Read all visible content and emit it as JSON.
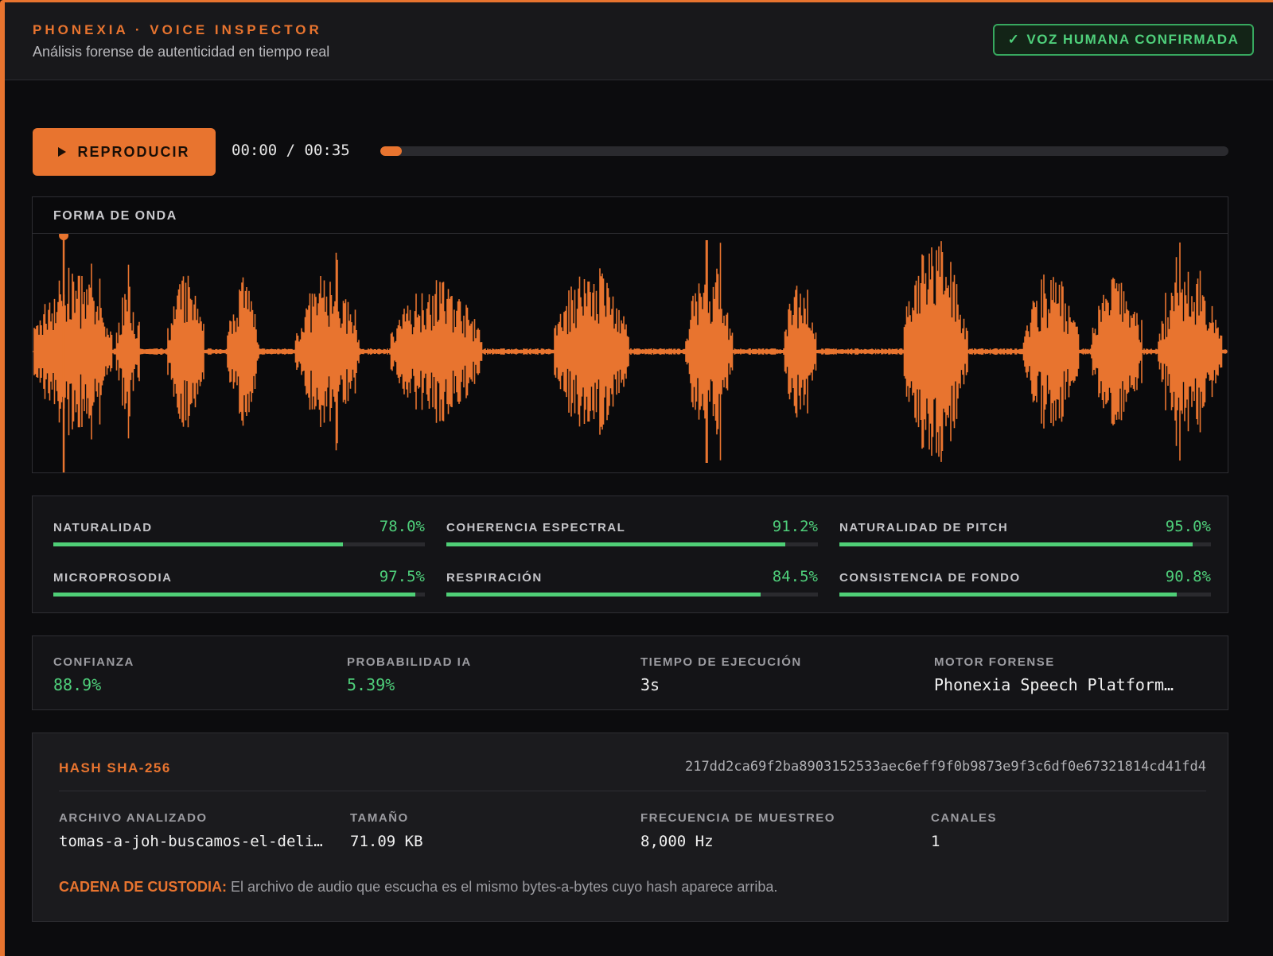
{
  "header": {
    "brand": "PHONEXIA · VOICE INSPECTOR",
    "subtitle": "Análisis forense de autenticidad en tiempo real",
    "verdict_icon": "check-icon",
    "verdict_symbol": "✓",
    "verdict_label": "VOZ HUMANA CONFIRMADA"
  },
  "player": {
    "play_label": "REPRODUCIR",
    "time": "00:00 / 00:35",
    "progress_fraction": 0.025
  },
  "waveform": {
    "title": "FORMA DE ONDA",
    "color": "#e8742f",
    "playhead_fraction": 0.026
  },
  "metrics": [
    {
      "label": "NATURALIDAD",
      "value": "78.0%",
      "fraction": 0.78
    },
    {
      "label": "COHERENCIA ESPECTRAL",
      "value": "91.2%",
      "fraction": 0.912
    },
    {
      "label": "NATURALIDAD DE PITCH",
      "value": "95.0%",
      "fraction": 0.95
    },
    {
      "label": "MICROPROSODIA",
      "value": "97.5%",
      "fraction": 0.975
    },
    {
      "label": "RESPIRACIÓN",
      "value": "84.5%",
      "fraction": 0.845
    },
    {
      "label": "CONSISTENCIA DE FONDO",
      "value": "90.8%",
      "fraction": 0.908
    }
  ],
  "stats": [
    {
      "label": "CONFIANZA",
      "value": "88.9%",
      "highlight": true
    },
    {
      "label": "PROBABILIDAD IA",
      "value": "5.39%",
      "highlight": true
    },
    {
      "label": "TIEMPO DE EJECUCIÓN",
      "value": "3s",
      "highlight": false
    },
    {
      "label": "MOTOR FORENSE",
      "value": "Phonexia Speech Platform…",
      "highlight": false
    }
  ],
  "custody": {
    "hash_label": "HASH SHA-256",
    "hash_value": "217dd2ca69f2ba8903152533aec6eff9f0b9873e9f3c6df0e67321814cd41fd4",
    "file_info": [
      {
        "label": "ARCHIVO ANALIZADO",
        "value": "tomas-a-joh-buscamos-el-deli…"
      },
      {
        "label": "TAMAÑO",
        "value": "71.09 KB"
      },
      {
        "label": "FRECUENCIA DE MUESTREO",
        "value": "8,000 Hz"
      },
      {
        "label": "CANALES",
        "value": "1"
      }
    ],
    "note_label": "CADENA DE CUSTODIA:",
    "note_text": " El archivo de audio que escucha es el mismo bytes-a-bytes cuyo hash aparece arriba."
  },
  "colors": {
    "accent": "#e8742f",
    "success": "#4fd07b",
    "background": "#0c0c0e"
  }
}
